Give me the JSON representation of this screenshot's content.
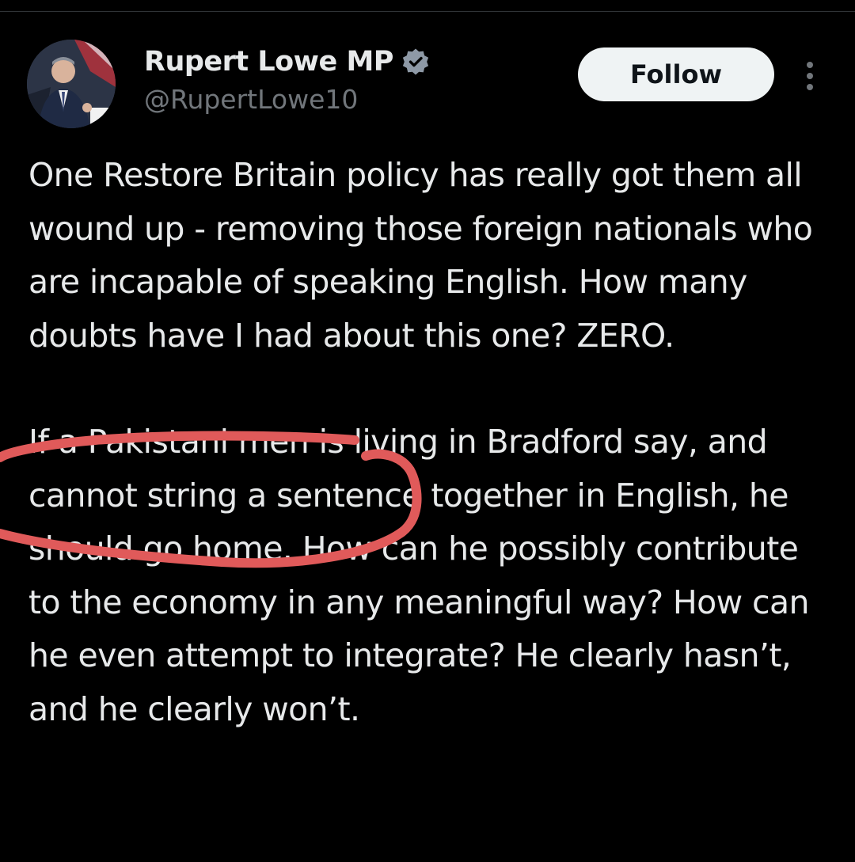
{
  "tweet": {
    "author": {
      "name": "Rupert Lowe MP",
      "handle": "@RupertLowe10",
      "verified": true,
      "avatar_icon": "profile-photo"
    },
    "follow_label": "Follow",
    "more_icon": "more-vertical-icon",
    "paragraphs": [
      "One Restore Britain policy has really got them all wound up - removing those foreign nationals who are incapable of speaking English. How many doubts have I had about this one? ZERO.",
      "If a Pakistani men is living in Bradford say, and cannot string a sentence together in English, he should go home. How can he possibly contribute to the economy in any meaningful way? How can he even attempt to integrate? He clearly hasn’t, and he clearly won’t."
    ]
  },
  "annotation": {
    "type": "hand-drawn-red-circle",
    "color": "#e05a5a"
  },
  "colors": {
    "background": "#000000",
    "text_primary": "#e7e9ea",
    "text_secondary": "#71767b",
    "verified_badge": "#8e99a6",
    "follow_bg": "#eff3f4"
  }
}
